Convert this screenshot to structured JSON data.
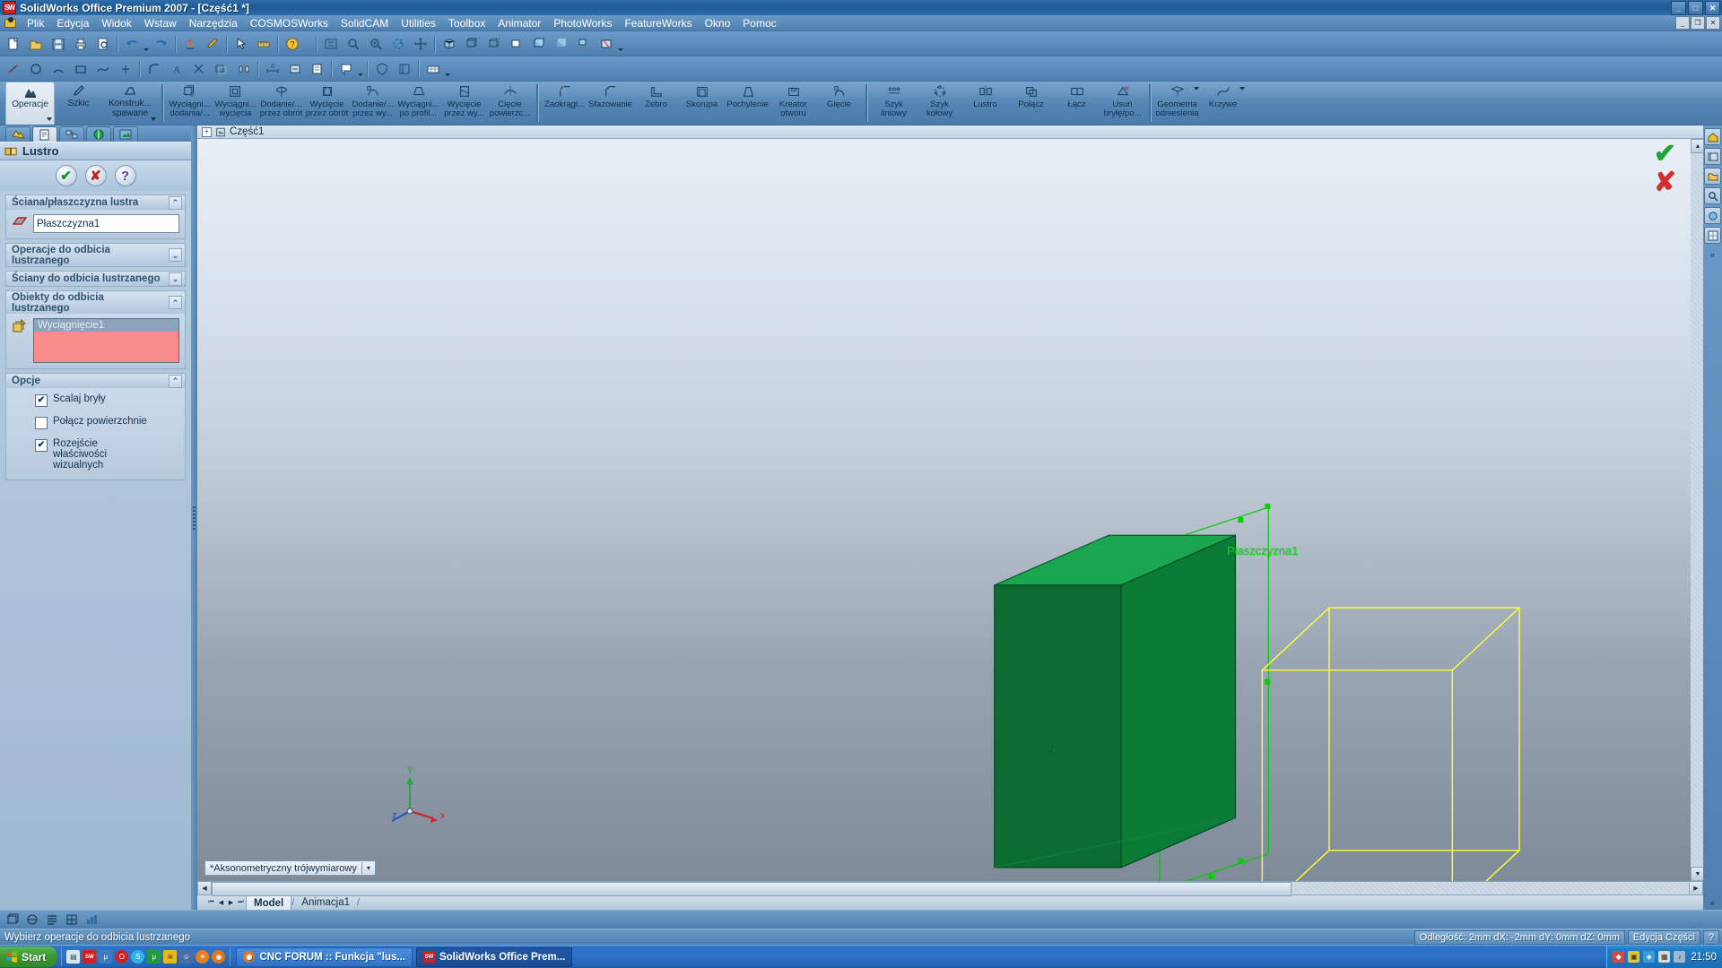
{
  "window": {
    "title": "SolidWorks Office Premium 2007 - [Część1 *]",
    "logo_text": "SW",
    "minimize": "_",
    "maximize": "□",
    "close": "✕",
    "mdi_minimize": "_",
    "mdi_restore": "❐",
    "mdi_close": "✕"
  },
  "menu": {
    "items": [
      {
        "label": "Plik"
      },
      {
        "label": "Edycja"
      },
      {
        "label": "Widok"
      },
      {
        "label": "Wstaw"
      },
      {
        "label": "Narzędzia"
      },
      {
        "label": "COSMOSWorks"
      },
      {
        "label": "SolidCAM"
      },
      {
        "label": "Utilities"
      },
      {
        "label": "Toolbox"
      },
      {
        "label": "Animator"
      },
      {
        "label": "PhotoWorks"
      },
      {
        "label": "FeatureWorks"
      },
      {
        "label": "Okno"
      },
      {
        "label": "Pomoc"
      }
    ]
  },
  "command_manager": {
    "tabs": [
      {
        "label": "Operacje",
        "active": true,
        "icon": "features-icon"
      },
      {
        "label": "Szkic",
        "active": false,
        "icon": "sketch-icon"
      },
      {
        "label": "Konstruk...",
        "sub": "spawane",
        "active": false,
        "icon": "weldments-icon"
      }
    ],
    "buttons": [
      {
        "l1": "Wyciągni...",
        "l2": "dodania/...",
        "icon": "extrude-boss-icon"
      },
      {
        "l1": "Wyciągni...",
        "l2": "wycięcia",
        "icon": "extrude-cut-icon"
      },
      {
        "l1": "Dodanie/...",
        "l2": "przez obrót",
        "icon": "revolve-boss-icon"
      },
      {
        "l1": "Wycięcie",
        "l2": "przez obrót",
        "icon": "revolve-cut-icon"
      },
      {
        "l1": "Dodanie/...",
        "l2": "przez wy...",
        "icon": "sweep-boss-icon"
      },
      {
        "l1": "Wyciągni...",
        "l2": "po profil...",
        "icon": "loft-boss-icon"
      },
      {
        "l1": "Wycięcie",
        "l2": "przez wy...",
        "icon": "sweep-cut-icon"
      },
      {
        "l1": "Cięcie",
        "l2": "powierzc...",
        "icon": "surface-cut-icon"
      },
      {
        "l1": "Zaokrągl...",
        "l2": "",
        "icon": "fillet-icon"
      },
      {
        "l1": "Sfazowanie",
        "l2": "",
        "icon": "chamfer-icon"
      },
      {
        "l1": "Żebro",
        "l2": "",
        "icon": "rib-icon"
      },
      {
        "l1": "Skorupa",
        "l2": "",
        "icon": "shell-icon"
      },
      {
        "l1": "Pochylenie",
        "l2": "",
        "icon": "draft-icon"
      },
      {
        "l1": "Kreator",
        "l2": "otworu",
        "icon": "hole-wizard-icon"
      },
      {
        "l1": "Gięcie",
        "l2": "",
        "icon": "flex-icon"
      },
      {
        "l1": "Szyk",
        "l2": "liniowy",
        "icon": "linear-pattern-icon"
      },
      {
        "l1": "Szyk",
        "l2": "kołowy",
        "icon": "circular-pattern-icon"
      },
      {
        "l1": "Lustro",
        "l2": "",
        "icon": "mirror-icon"
      },
      {
        "l1": "Połącz",
        "l2": "",
        "icon": "combine-icon"
      },
      {
        "l1": "Łącz",
        "l2": "",
        "icon": "join-icon"
      },
      {
        "l1": "Usuń",
        "l2": "bryłę/po...",
        "icon": "delete-body-icon"
      },
      {
        "l1": "Geometria",
        "l2": "odniesienia",
        "icon": "reference-geometry-icon",
        "dropdown": true
      },
      {
        "l1": "Krzywe",
        "l2": "",
        "icon": "curves-icon",
        "dropdown": true
      }
    ]
  },
  "property_manager": {
    "tabs": [
      {
        "name": "feature-manager-tab",
        "active": false
      },
      {
        "name": "property-manager-tab",
        "active": true
      },
      {
        "name": "configuration-manager-tab",
        "active": false
      },
      {
        "name": "dimxpert-manager-tab",
        "active": false
      },
      {
        "name": "display-manager-tab",
        "active": false
      }
    ],
    "title": "Lustro",
    "ok_label": "✔",
    "cancel_label": "✘",
    "help_label": "?",
    "groups": {
      "mirror_face": {
        "header": "Ściana/płaszczyzna lustra",
        "value": "Płaszczyzna1",
        "collapse": "⌃"
      },
      "features_to_mirror": {
        "header_line1": "Operacje do odbicia",
        "header_line2": "lustrzanego",
        "collapse": "⌄"
      },
      "faces_to_mirror": {
        "header": "Ściany do odbicia lustrzanego",
        "collapse": "⌄"
      },
      "bodies_to_mirror": {
        "header_line1": "Obiekty do odbicia",
        "header_line2": "lustrzanego",
        "collapse": "⌃",
        "items": [
          "Wyciągnięcie1"
        ]
      },
      "options": {
        "header": "Opcje",
        "collapse": "⌃",
        "checkboxes": [
          {
            "label": "Scalaj bryły",
            "checked": true
          },
          {
            "label": "Połącz powierzchnie",
            "checked": false
          },
          {
            "label": "Rozejście właściwości wizualnych",
            "checked": true
          }
        ]
      }
    }
  },
  "graphics": {
    "tree_root": "Część1",
    "plane_label": "Płaszczyzna1",
    "confirm_ok": "✔",
    "confirm_cancel": "✘",
    "view_orientation": "*Aksonometryczny trójwymiarowy",
    "view_dropdown": "▾",
    "triad": {
      "x": "x",
      "y": "Y",
      "z": "z"
    },
    "colors": {
      "solid_top": "#1fab55",
      "solid_front": "#0a6b2e",
      "solid_side": "#0d7a38",
      "mirror_preview": "#f5f53c",
      "plane": "#00d000"
    }
  },
  "model_tabs": {
    "first": "⏮",
    "prev": "◀",
    "next": "▶",
    "last": "⏭",
    "tabs": [
      {
        "label": "Model",
        "active": true
      },
      {
        "label": "Animacja1",
        "active": false
      }
    ]
  },
  "status_bar": {
    "message": "Wybierz operacje do odbicia lustrzanego",
    "distance": "Odległość: 2mm    dX: -2mm  dY: 0mm  dZ: 0mm",
    "edit_mode": "Edycja Części",
    "indicator": "?"
  },
  "taskbar": {
    "start": "Start",
    "quick_launch": [
      {
        "name": "show-desktop-icon",
        "color": "#d9e6f2",
        "glyph": "▤"
      },
      {
        "name": "solidworks-icon",
        "color": "#cf2026",
        "glyph": "SW"
      },
      {
        "name": "utorrent-icon",
        "color": "#2f74c9",
        "glyph": "μ"
      },
      {
        "name": "opera-icon",
        "color": "#cc2222",
        "glyph": "O"
      },
      {
        "name": "skype-icon",
        "color": "#2fb3e8",
        "glyph": "S"
      },
      {
        "name": "mu-icon",
        "color": "#1f9b3f",
        "glyph": "μ"
      },
      {
        "name": "winamp-icon",
        "color": "#e5b820",
        "glyph": "≋"
      },
      {
        "name": "gadu-gadu-icon",
        "color": "#4a6fa5",
        "glyph": "☺"
      },
      {
        "name": "sun-icon",
        "color": "#e8801a",
        "glyph": "☀"
      },
      {
        "name": "firefox-icon",
        "color": "#e0761a",
        "glyph": "◉"
      }
    ],
    "tasks": [
      {
        "label": "CNC FORUM :: Funkcja \"lus...",
        "icon": "firefox-icon",
        "active": false
      },
      {
        "label": "SolidWorks Office Prem...",
        "icon": "solidworks-icon",
        "active": true
      }
    ],
    "tray_icons": [
      {
        "name": "volume-icon",
        "color": "#d04a4a",
        "glyph": "◆"
      },
      {
        "name": "network-icon",
        "color": "#e8c23a",
        "glyph": "▣"
      },
      {
        "name": "security-icon",
        "color": "#3a9bd9",
        "glyph": "◈"
      },
      {
        "name": "antivirus-icon",
        "color": "#d9d9d9",
        "glyph": "▦"
      },
      {
        "name": "speaker-icon",
        "color": "#9fb8cf",
        "glyph": "♪"
      }
    ],
    "clock": "21:50"
  }
}
